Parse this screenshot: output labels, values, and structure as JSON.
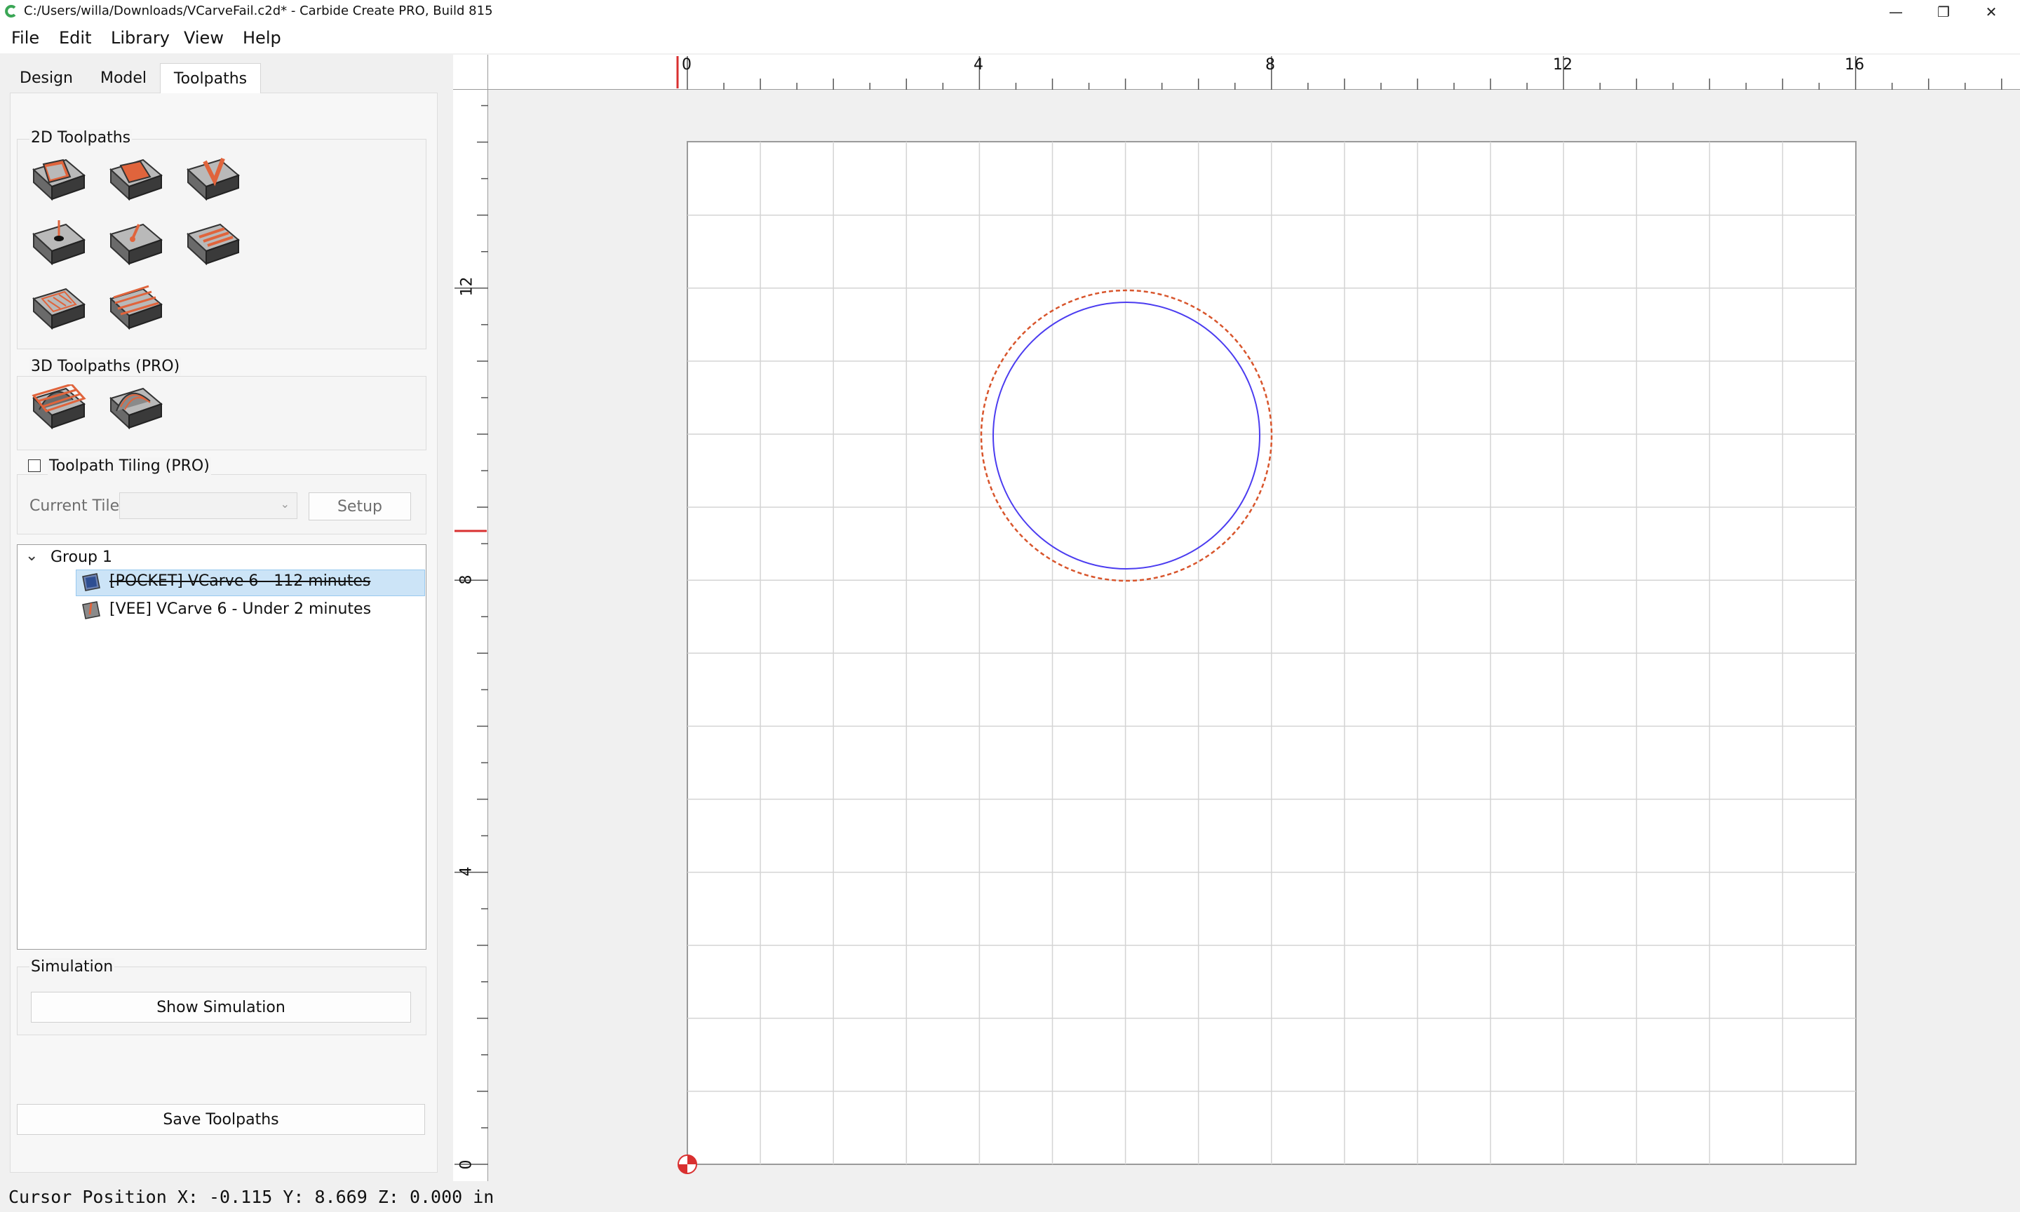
{
  "window": {
    "title": "C:/Users/willa/Downloads/VCarveFail.c2d* - Carbide Create PRO, Build 815",
    "minimize_glyph": "—",
    "restore_glyph": "❐",
    "close_glyph": "✕"
  },
  "menu": {
    "file": "File",
    "edit": "Edit",
    "library": "Library",
    "view": "View",
    "help": "Help"
  },
  "tabs": {
    "design": "Design",
    "model": "Model",
    "toolpaths": "Toolpaths",
    "active": "Toolpaths"
  },
  "toolpaths_2d": {
    "label": "2D Toolpaths",
    "icons": [
      "contour-toolpath-icon",
      "pocket-toolpath-icon",
      "vcarve-toolpath-icon",
      "drill-toolpath-icon",
      "chamfer-toolpath-icon",
      "texture-toolpath-icon",
      "advanced-vcarve-toolpath-icon",
      "flatten-toolpath-icon"
    ]
  },
  "toolpaths_3d": {
    "label": "3D Toolpaths (PRO)",
    "icons": [
      "3d-rough-toolpath-icon",
      "3d-finish-toolpath-icon"
    ]
  },
  "tiling": {
    "label": "Toolpath Tiling (PRO)",
    "checked": false,
    "current_tile_label": "Current Tile",
    "current_tile_value": "",
    "setup_label": "Setup"
  },
  "tree": {
    "group_label": "Group 1",
    "expanded": true,
    "items": [
      {
        "label": "[POCKET] VCarve 6 - 112 minutes",
        "selected": true,
        "struck": true
      },
      {
        "label": "[VEE] VCarve 6 - Under 2 minutes",
        "selected": false,
        "struck": false
      }
    ]
  },
  "simulation": {
    "label": "Simulation",
    "show_button": "Show Simulation"
  },
  "save_button": "Save Toolpaths",
  "ruler": {
    "top_labels": [
      "0",
      "4",
      "8",
      "12",
      "16"
    ],
    "left_labels": [
      "12",
      "8",
      "4",
      "0"
    ]
  },
  "status": {
    "text": "Cursor Position X: -0.115 Y: 8.669 Z: 0.000 in"
  },
  "colors": {
    "accent_orange": "#e0643c",
    "circle_blue": "#4b3cf0",
    "ruler_marker_red": "#d93030",
    "selection_bg": "#cce4f7"
  }
}
